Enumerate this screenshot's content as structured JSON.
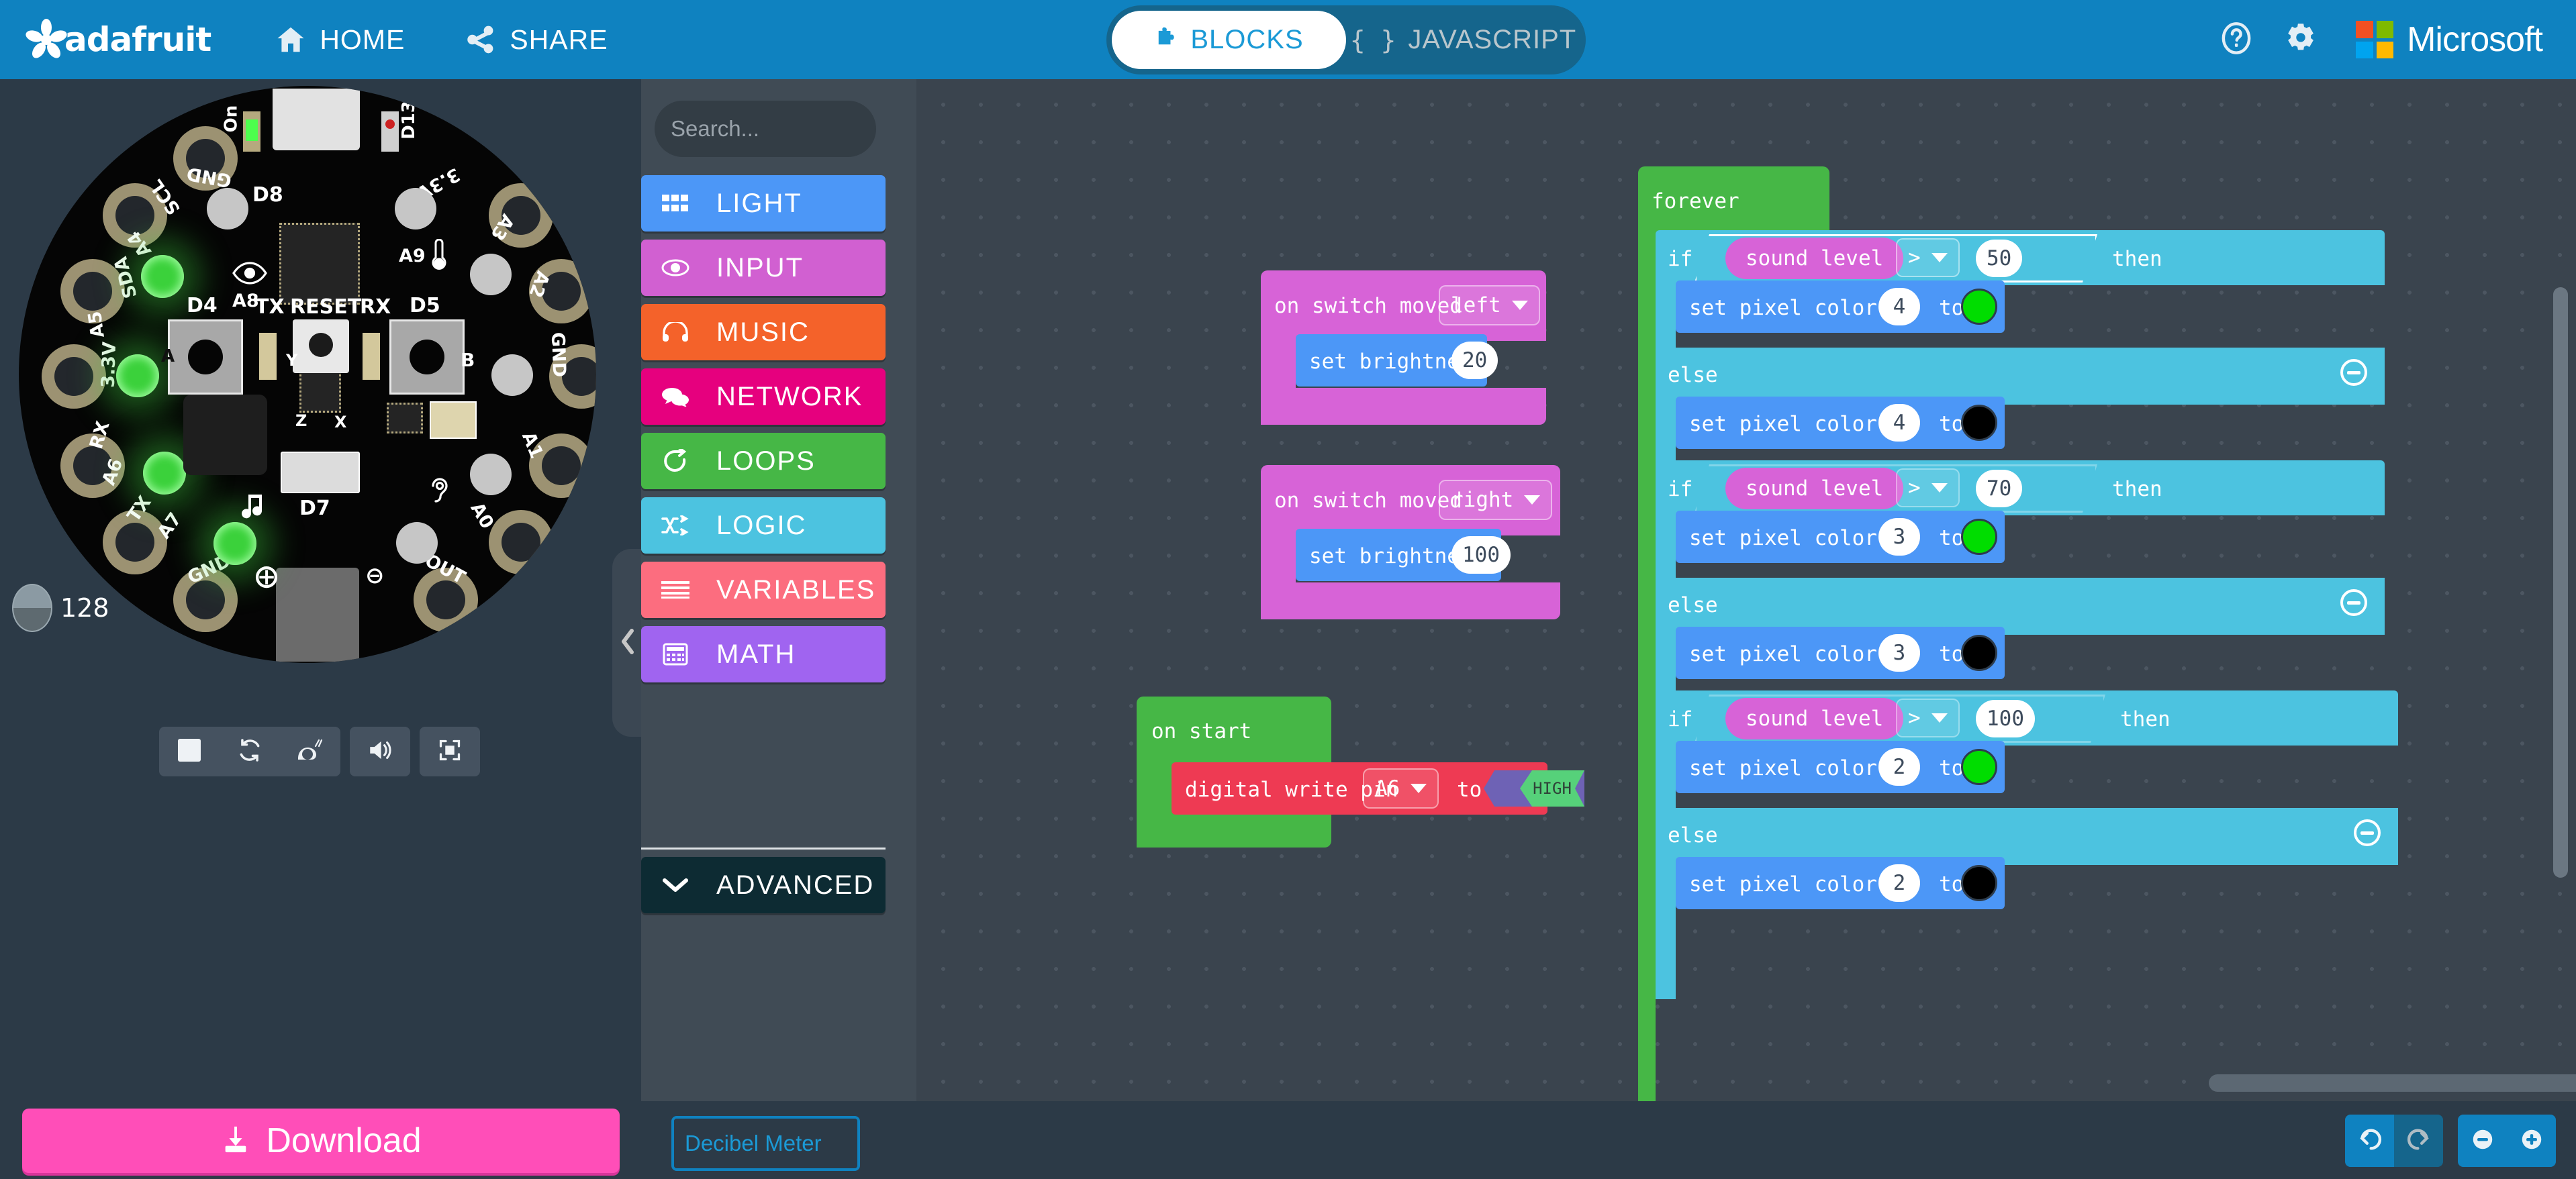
{
  "header": {
    "brand_name": "adafruit",
    "nav": [
      {
        "label": "HOME",
        "icon": "home-icon"
      },
      {
        "label": "SHARE",
        "icon": "share-icon"
      }
    ],
    "tabs": [
      {
        "label": "BLOCKS",
        "icon": "puzzle-icon",
        "active": true
      },
      {
        "label": "JAVASCRIPT",
        "icon": "braces-icon",
        "active": false
      }
    ],
    "help_icon": "help-circle-icon",
    "settings_icon": "gear-icon",
    "microsoft_label": "Microsoft",
    "ms_colors": [
      "#f25022",
      "#7fba00",
      "#00a4ef",
      "#ffb900"
    ],
    "bg_color": "#0f82c0"
  },
  "simulator": {
    "slider_value": "128",
    "board_pads": [
      {
        "label": "GND"
      },
      {
        "label": "SCL"
      },
      {
        "label": "A4"
      },
      {
        "label": "SDA"
      },
      {
        "label": "A5"
      },
      {
        "label": "3.3V"
      },
      {
        "label": "RX"
      },
      {
        "label": "A6"
      },
      {
        "label": "TX"
      },
      {
        "label": "A7"
      },
      {
        "label": "GND"
      },
      {
        "label": "A0"
      },
      {
        "label": "VOUT"
      },
      {
        "label": "A1"
      },
      {
        "label": "GND"
      },
      {
        "label": "A2"
      },
      {
        "label": "A3"
      },
      {
        "label": "3.3V"
      }
    ],
    "board_marks": [
      {
        "label": "On"
      },
      {
        "label": "D13"
      },
      {
        "label": "D8"
      },
      {
        "label": "A8"
      },
      {
        "label": "A9"
      },
      {
        "label": "D4"
      },
      {
        "label": "TX"
      },
      {
        "label": "RESET"
      },
      {
        "label": "RX"
      },
      {
        "label": "D5"
      },
      {
        "label": "A"
      },
      {
        "label": "B"
      },
      {
        "label": "D7"
      },
      {
        "label": "Y"
      },
      {
        "label": "X"
      },
      {
        "label": "Z"
      }
    ],
    "controls": [
      {
        "name": "stop-button",
        "icon": "stop-icon"
      },
      {
        "name": "restart-button",
        "icon": "refresh-icon"
      },
      {
        "name": "slow-motion-button",
        "icon": "snail-icon"
      },
      {
        "name": "mute-button",
        "icon": "volume-icon"
      },
      {
        "name": "fullscreen-button",
        "icon": "expand-icon"
      }
    ],
    "collapse_icon": "chevron-left-icon"
  },
  "toolbox": {
    "search_placeholder": "Search...",
    "search_value": "",
    "search_icon": "search-icon",
    "categories": [
      {
        "label": "LIGHT",
        "color": "#4c97f7",
        "icon": "grid-icon"
      },
      {
        "label": "INPUT",
        "color": "#d160d1",
        "icon": "eye-icon"
      },
      {
        "label": "MUSIC",
        "color": "#f4622a",
        "icon": "headphones-icon"
      },
      {
        "label": "NETWORK",
        "color": "#e6007e",
        "icon": "chat-icon"
      },
      {
        "label": "LOOPS",
        "color": "#46b746",
        "icon": "loop-icon"
      },
      {
        "label": "LOGIC",
        "color": "#4cc3e0",
        "icon": "shuffle-icon"
      },
      {
        "label": "VARIABLES",
        "color": "#fc6d7f",
        "icon": "lines-icon"
      },
      {
        "label": "MATH",
        "color": "#a064f0",
        "icon": "calculator-icon"
      }
    ],
    "advanced": {
      "label": "ADVANCED",
      "color": "#0d2b33",
      "icon": "chevron-down-icon"
    }
  },
  "workspace": {
    "blocks": {
      "switch_left": {
        "event_label": "on switch moved",
        "dropdown_value": "left",
        "child_label": "set brightness",
        "child_value": "20"
      },
      "switch_right": {
        "event_label": "on switch moved",
        "dropdown_value": "right",
        "child_label": "set brightness",
        "child_value": "100"
      },
      "on_start": {
        "event_label": "on start",
        "child_label_a": "digital write pin",
        "pin_value": "A6",
        "child_label_b": "to",
        "bool_value": "HIGH"
      },
      "forever": {
        "event_label": "forever",
        "conditions": [
          {
            "if_label": "if",
            "sensor": "sound level",
            "operator": ">",
            "threshold": "50",
            "then_label": "then",
            "then_body": {
              "label_a": "set pixel color at",
              "index": "4",
              "label_b": "to",
              "color": "#00dd00"
            },
            "else_label": "else",
            "else_body": {
              "label_a": "set pixel color at",
              "index": "4",
              "label_b": "to",
              "color": "#000000"
            }
          },
          {
            "if_label": "if",
            "sensor": "sound level",
            "operator": ">",
            "threshold": "70",
            "then_label": "then",
            "then_body": {
              "label_a": "set pixel color at",
              "index": "3",
              "label_b": "to",
              "color": "#00dd00"
            },
            "else_label": "else",
            "else_body": {
              "label_a": "set pixel color at",
              "index": "3",
              "label_b": "to",
              "color": "#000000"
            }
          },
          {
            "if_label": "if",
            "sensor": "sound level",
            "operator": ">",
            "threshold": "100",
            "then_label": "then",
            "then_body": {
              "label_a": "set pixel color at",
              "index": "2",
              "label_b": "to",
              "color": "#00dd00"
            },
            "else_label": "else",
            "else_body": {
              "label_a": "set pixel color at",
              "index": "2",
              "label_b": "to",
              "color": "#000000"
            }
          }
        ]
      }
    },
    "colors": {
      "event_pink": "#d763d7",
      "light_blue": "#4c97f7",
      "loop_green": "#46b746",
      "logic_blue": "#4cc3e0",
      "pins_red": "#ee3a53",
      "bool_purple": "#6e62b5"
    }
  },
  "footer": {
    "download_label": "Download",
    "download_icon": "download-icon",
    "project_name_placeholder": "Decibel Meter",
    "project_name_value": "",
    "save_icon": "save-icon",
    "undo_icon": "undo-icon",
    "redo_icon": "redo-icon",
    "zoom_out_icon": "minus-circle-icon",
    "zoom_in_icon": "plus-circle-icon"
  }
}
